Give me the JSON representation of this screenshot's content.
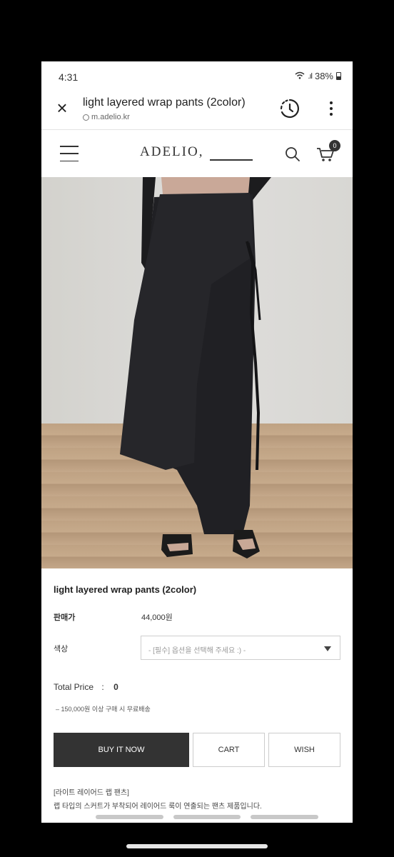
{
  "status_bar": {
    "time": "4:31",
    "signal": "὏6 .ıl",
    "battery": "38%"
  },
  "browser": {
    "title": "light layered wrap pants (2color)",
    "url": "m.adelio.kr"
  },
  "site": {
    "logo": "ADELIO,",
    "cart_count": "0"
  },
  "product": {
    "name": "light layered wrap pants (2color)",
    "price_label": "판매가",
    "price": "44,000원",
    "color_label": "색상",
    "color_placeholder": "- [필수] 옵션을 선택해 주세요 :) -",
    "total_label": "Total Price",
    "total_sep": ":",
    "total_value": "0",
    "shipping_note": "– 150,000원 이상 구매 시 무료배송",
    "buttons": {
      "buy": "BUY IT NOW",
      "cart": "CART",
      "wish": "WISH"
    },
    "desc_title": "[라이트 레이어드 랩 팬츠]",
    "desc_body": "랩 타입의 스커트가 부착되어 레이어드 룩이 연출되는 팬츠 제품입니다."
  },
  "icons": [
    "close-icon",
    "info-icon",
    "history-icon",
    "more-icon",
    "menu-icon",
    "search-icon",
    "cart-icon"
  ],
  "colors": {
    "button_dark": "#333333",
    "page_bg": "#000000"
  }
}
